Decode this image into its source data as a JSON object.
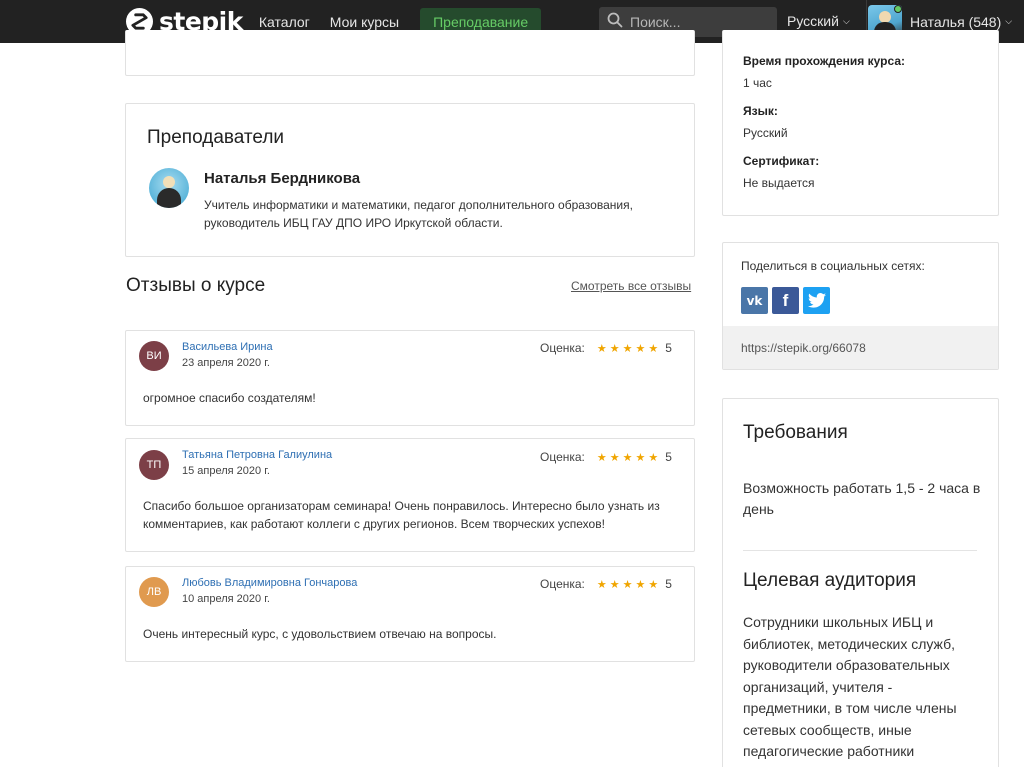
{
  "navbar": {
    "logo_text": "stepik",
    "catalog": "Каталог",
    "my_courses": "Мои курсы",
    "teaching": "Преподавание",
    "search_placeholder": "Поиск...",
    "language": "Русский",
    "user_name": "Наталья (548)"
  },
  "course_info": {
    "duration_label": "Время прохождения курса:",
    "duration_value": "1 час",
    "language_label": "Язык:",
    "language_value": "Русский",
    "certificate_label": "Сертификат:",
    "certificate_value": "Не выдается"
  },
  "teachers": {
    "title": "Преподаватели",
    "items": [
      {
        "name": "Наталья Бердникова",
        "description": "Учитель информатики и математики, педагог дополнительного образования, руководитель ИБЦ ГАУ ДПО ИРО Иркутской области."
      }
    ]
  },
  "reviews": {
    "title": "Отзывы о курсе",
    "see_all": "Смотреть все отзывы",
    "rating_label": "Оценка:",
    "stars": "★★★★★",
    "items": [
      {
        "initials": "ВИ",
        "avatar_color": "#7c3f47",
        "author": "Васильева Ирина",
        "date": "23 апреля 2020 г.",
        "score": "5",
        "text": "огромное спасибо создателям!"
      },
      {
        "initials": "ТП",
        "avatar_color": "#7c3f47",
        "author": "Татьяна Петровна Галиулина",
        "date": "15 апреля 2020 г.",
        "score": "5",
        "text": "Спасибо большое организаторам семинара! Очень понравилось. Интересно было узнать из комментариев, как работают коллеги с других регионов. Всем творческих успехов!"
      },
      {
        "initials": "ЛВ",
        "avatar_color": "#e09a4f",
        "author": "Любовь Владимировна Гончарова",
        "date": "10 апреля 2020 г.",
        "score": "5",
        "text": "Очень интересный курс, с удовольствием отвечаю на вопросы."
      }
    ]
  },
  "share": {
    "title": "Поделиться в социальных сетях:",
    "vk": "vk",
    "fb": "f",
    "url": "https://stepik.org/66078"
  },
  "requirements": {
    "title": "Требования",
    "text": "Возможность работать 1,5 - 2 часа в день"
  },
  "audience": {
    "title": "Целевая аудитория",
    "text": "Сотрудники школьных ИБЦ и библиотек, методических служб, руководители образовательных организаций, учителя - предметники, в том числе члены сетевых сообществ, иные педагогические работники"
  },
  "colors": {
    "navbar_bg": "#222222",
    "teaching_accent": "#66cc66",
    "link": "#2e6fb3",
    "star": "#f0a500",
    "vk": "#4a76a8",
    "facebook": "#3b5998",
    "twitter": "#1da1f2"
  }
}
